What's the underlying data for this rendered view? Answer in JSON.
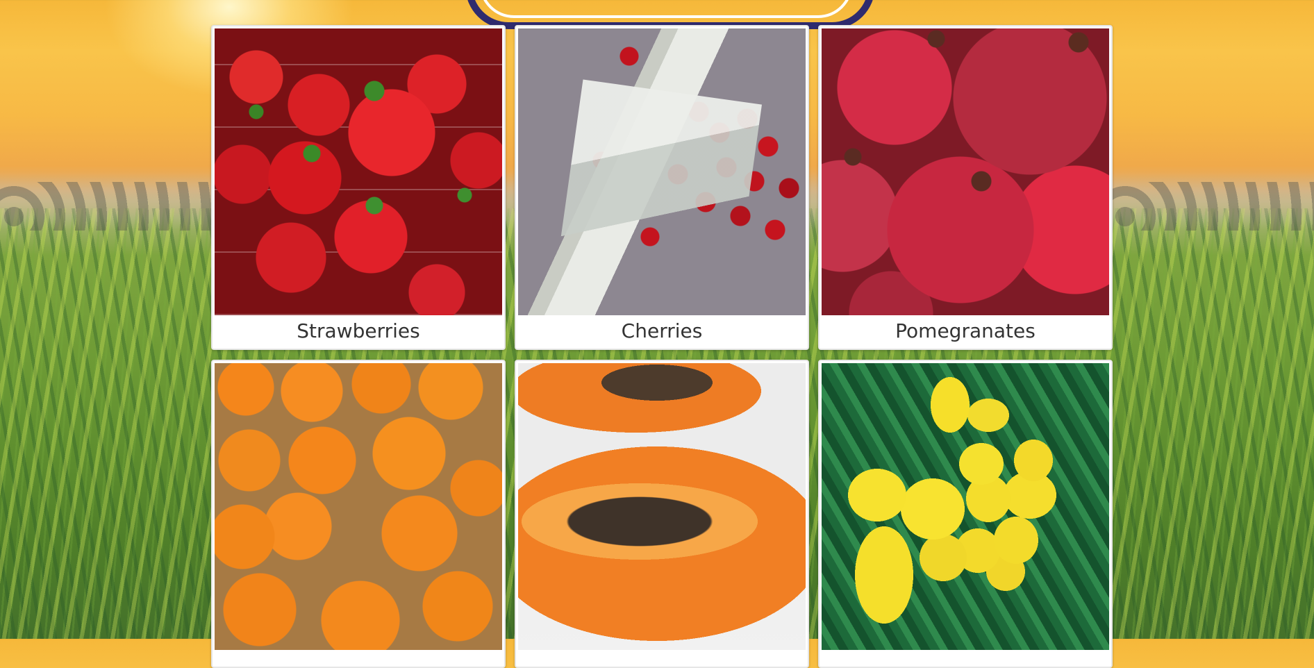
{
  "gallery": {
    "items": [
      {
        "label": "Strawberries"
      },
      {
        "label": "Cherries"
      },
      {
        "label": "Pomegranates"
      },
      {
        "label": ""
      },
      {
        "label": ""
      },
      {
        "label": ""
      }
    ]
  },
  "colors": {
    "logo_outline": "#2f2b6e",
    "card_background": "#ffffff",
    "caption_text": "#333333"
  }
}
